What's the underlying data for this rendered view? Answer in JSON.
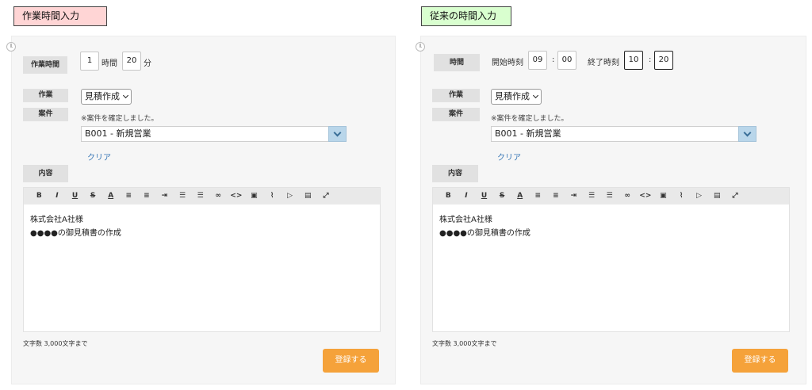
{
  "left": {
    "caption": "作業時間入力",
    "time_label": "作業時間",
    "hours": "1",
    "hours_unit": "時間",
    "minutes": "20",
    "minutes_unit": "分",
    "work_label": "作業",
    "work_value": "見積作成",
    "case_label": "案件",
    "case_note": "※案件を確定しました。",
    "case_value": "B001 - 新規営業",
    "clear": "クリア",
    "content_label": "内容",
    "content_lines": [
      "株式会社A社様",
      "●●●●の御見積書の作成"
    ],
    "counter": "文字数 3,000文字まで",
    "submit": "登録する"
  },
  "right": {
    "caption": "従来の時間入力",
    "time_label": "時間",
    "start_label": "開始時刻",
    "start_hour": "09",
    "start_min": "00",
    "end_label": "終了時刻",
    "end_hour": "10",
    "end_min": "20",
    "colon": ":",
    "work_label": "作業",
    "work_value": "見積作成",
    "case_label": "案件",
    "case_note": "※案件を確定しました。",
    "case_value": "B001 - 新規営業",
    "clear": "クリア",
    "content_label": "内容",
    "content_lines": [
      "株式会社A社様",
      "●●●●の御見積書の作成"
    ],
    "counter": "文字数 3,000文字まで",
    "submit": "登録する"
  },
  "toolbar": [
    {
      "name": "bold-icon",
      "glyph": "B"
    },
    {
      "name": "italic-icon",
      "glyph": "I"
    },
    {
      "name": "underline-icon",
      "glyph": "U"
    },
    {
      "name": "strikethrough-icon",
      "glyph": "S"
    },
    {
      "name": "text-color-icon",
      "glyph": "A"
    },
    {
      "name": "align-left-icon",
      "glyph": "≡"
    },
    {
      "name": "align-right-icon",
      "glyph": "≡"
    },
    {
      "name": "indent-icon",
      "glyph": "⇥"
    },
    {
      "name": "bullet-list-icon",
      "glyph": "☰"
    },
    {
      "name": "numbered-list-icon",
      "glyph": "☰"
    },
    {
      "name": "link-icon",
      "glyph": "∞"
    },
    {
      "name": "code-icon",
      "glyph": "<>"
    },
    {
      "name": "image-icon",
      "glyph": "▣"
    },
    {
      "name": "attachment-icon",
      "glyph": "⌇"
    },
    {
      "name": "video-icon",
      "glyph": "▷"
    },
    {
      "name": "document-icon",
      "glyph": "▤"
    },
    {
      "name": "fullscreen-icon",
      "glyph": "⤢"
    }
  ]
}
